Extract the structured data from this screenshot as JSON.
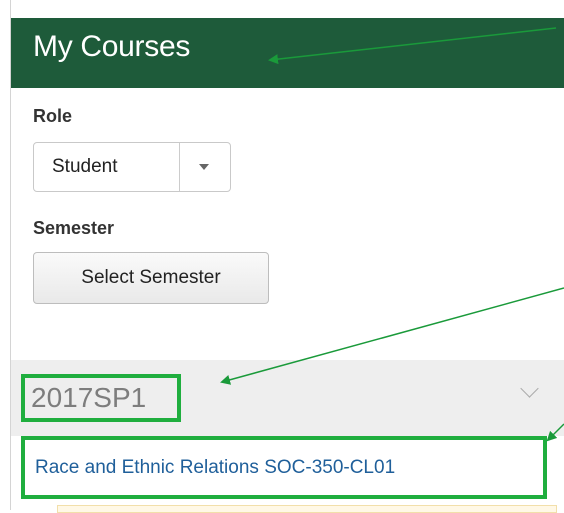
{
  "header": {
    "title": "My Courses"
  },
  "role": {
    "label": "Role",
    "selected": "Student"
  },
  "semester": {
    "label": "Semester",
    "button_label": "Select Semester"
  },
  "term": {
    "name": "2017SP1"
  },
  "course": {
    "name": "Race and Ethnic Relations SOC-350-CL01"
  },
  "colors": {
    "header_bg": "#1e5b3a",
    "highlight": "#1fae3e",
    "link": "#1f5f9a",
    "arrow": "#1a9a3a"
  },
  "icons": [
    "chevron-down-icon",
    "dropdown-caret-icon",
    "arrow-annotation-icon"
  ]
}
